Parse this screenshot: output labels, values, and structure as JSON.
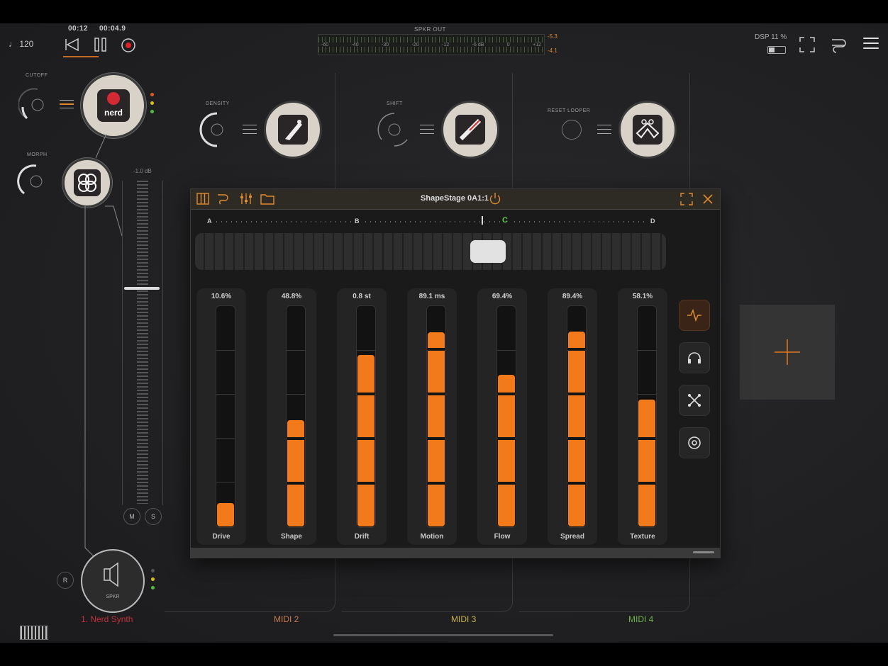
{
  "topbar": {
    "tempo": "♩ 120",
    "time_a": "00:12",
    "time_b": "00:04.9",
    "meter_title": "SPKR OUT",
    "meter_scale": [
      "-60",
      "-40",
      "-30",
      "-20",
      "-12",
      "-6  dB",
      "0",
      "+12"
    ],
    "meter_peak_a": "-5.3",
    "meter_peak_b": "-4.1",
    "dsp_label": "DSP 11 %"
  },
  "track1": {
    "cutoff_label": "CUTOFF",
    "morph_label": "MORPH",
    "plugin_logo_text": "nerd",
    "fader_db": "-1.0 dB",
    "mute_label": "M",
    "solo_label": "S",
    "output_label": "SPKR",
    "record_label": "R",
    "name": "1. Nerd Synth"
  },
  "track2": {
    "knob_label": "DENSITY",
    "name": "MIDI 2"
  },
  "track3": {
    "knob_label": "SHIFT",
    "name": "MIDI 3"
  },
  "track4": {
    "knob_label": "RESET LOOPER",
    "name": "MIDI 4"
  },
  "plugin_window": {
    "title": "ShapeStage 0A1:1",
    "morph_positions": [
      "A",
      "B",
      "C",
      "D"
    ],
    "active_position": "C",
    "morph_value": 0.6,
    "sliders": [
      {
        "label": "Drive",
        "value_text": "10.6%",
        "level": 0.106
      },
      {
        "label": "Shape",
        "value_text": "48.8%",
        "level": 0.488
      },
      {
        "label": "Drift",
        "value_text": "0.8 st",
        "level": 0.787
      },
      {
        "label": "Motion",
        "value_text": "89.1 ms",
        "level": 0.891
      },
      {
        "label": "Flow",
        "value_text": "69.4%",
        "level": 0.694
      },
      {
        "label": "Spread",
        "value_text": "89.4%",
        "level": 0.894
      },
      {
        "label": "Texture",
        "value_text": "58.1%",
        "level": 0.581
      }
    ],
    "side_buttons": [
      "waveform-icon",
      "headphones-icon",
      "shuffle-icon",
      "settings-icon"
    ]
  },
  "colors": {
    "accent": "#f27a1a",
    "track1_name": "#c0303a",
    "track2_name": "#c8794a",
    "track3_name": "#c9b245",
    "track4_name": "#6fb04a"
  }
}
